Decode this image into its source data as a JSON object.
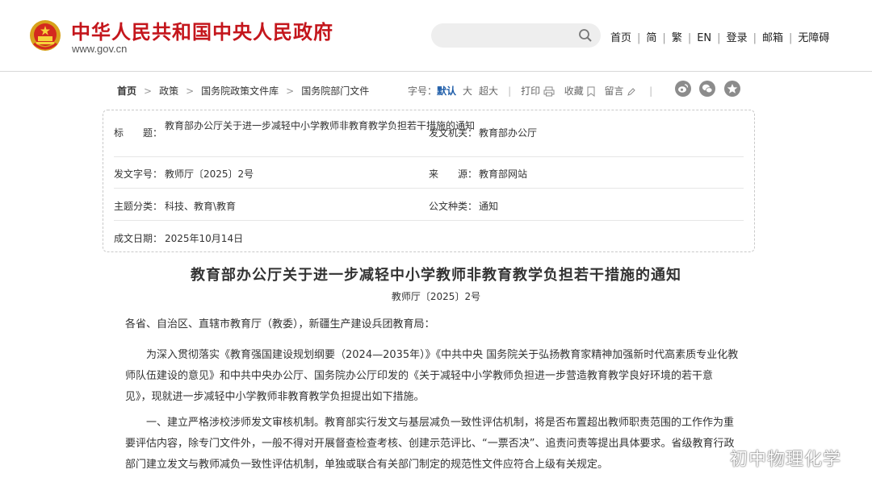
{
  "header": {
    "site_title": "中华人民共和国中央人民政府",
    "site_url": "www.gov.cn",
    "search": {
      "placeholder": ""
    },
    "nav": [
      "首页",
      "简",
      "繁",
      "EN",
      "登录",
      "邮箱",
      "无障碍"
    ]
  },
  "breadcrumb": [
    "首页",
    "政策",
    "国务院政策文件库",
    "国务院部门文件"
  ],
  "tools": {
    "font_label": "字号：",
    "font_default": "默认",
    "font_large": "大",
    "font_xlarge": "超大",
    "print": "打印",
    "favorite": "收藏",
    "comment": "留言"
  },
  "share_icons": [
    "weibo-icon",
    "wechat-icon",
    "star-icon"
  ],
  "info": {
    "title_label": "标　　题：",
    "title_value": "教育部办公厅关于进一步减轻中小学教师非教育教学负担若干措施的通知",
    "issuer_label": "发文机关：",
    "issuer_value": "教育部办公厅",
    "doc_no_label": "发文字号：",
    "doc_no_value": "教师厅〔2025〕2号",
    "source_label": "来　　源：",
    "source_value": "教育部网站",
    "topic_label": "主题分类：",
    "topic_value": "科技、教育\\教育",
    "type_label": "公文种类：",
    "type_value": "通知",
    "date_label": "成文日期：",
    "date_value": "2025年10月14日"
  },
  "document": {
    "title": "教育部办公厅关于进一步减轻中小学教师非教育教学负担若干措施的通知",
    "number": "教师厅〔2025〕2号",
    "salutation": "各省、自治区、直辖市教育厅（教委），新疆生产建设兵团教育局：",
    "para1": "为深入贯彻落实《教育强国建设规划纲要（2024—2035年）》《中共中央 国务院关于弘扬教育家精神加强新时代高素质专业化教师队伍建设的意见》和中共中央办公厅、国务院办公厅印发的《关于减轻中小学教师负担进一步营造教育教学良好环境的若干意见》，现就进一步减轻中小学教师非教育教学负担提出如下措施。",
    "para2": "一、建立严格涉校涉师发文审核机制。教育部实行发文与基层减负一致性评估机制，将是否布置超出教师职责范围的工作作为重要评估内容，除专门文件外，一般不得对开展督查检查考核、创建示范评比、“一票否决”、追责问责等提出具体要求。省级教育行政部门建立发文与教师减负一致性评估机制，单独或联合有关部门制定的规范性文件应符合上级有关规定。"
  },
  "watermark": "初中物理化学",
  "colors": {
    "brand_red": "#c4161c",
    "link_blue": "#1d5ca8"
  }
}
